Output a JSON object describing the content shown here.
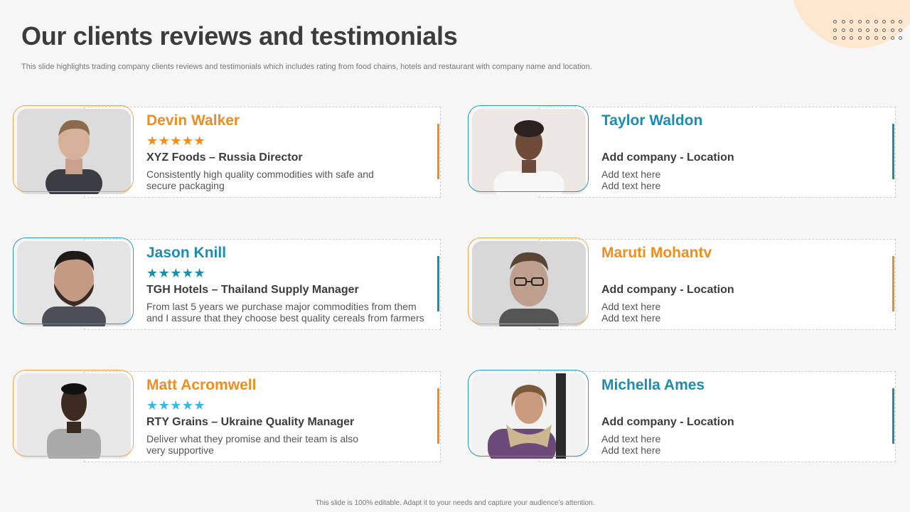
{
  "slide": {
    "title": "Our clients reviews and testimonials",
    "subtitle": "This slide highlights trading company clients reviews and testimonials which includes rating from food chains, hotels and restaurant with company name and location.",
    "footer": "This slide is 100% editable. Adapt it to your needs and capture your audience’s attention."
  },
  "colors": {
    "orange": "#ef8d1e",
    "blue": "#1c8db2",
    "star_orange": "#ef8d1e",
    "star_blue": "#1c8db2",
    "star_light_blue": "#3bb8e0",
    "background": "#f6f6f6"
  },
  "testimonials": [
    {
      "name": "Devin Walker",
      "theme": "orange",
      "rating": 5,
      "stars": "★★★★★",
      "star_color": "#ef8d1e",
      "company": "XYZ Foods – Russia Director",
      "desc_line1": "Consistently high quality commodities with safe and",
      "desc_line2": "secure packaging",
      "photo_icon": "man-portrait-photo"
    },
    {
      "name": "Taylor Waldon",
      "theme": "blue",
      "rating": null,
      "stars": "",
      "star_color": "#1c8db2",
      "company": "Add company - Location",
      "desc_line1": "Add text here",
      "desc_line2": "Add text here",
      "photo_icon": "woman-portrait-photo"
    },
    {
      "name": "Jason Knill",
      "theme": "blue",
      "rating": 5,
      "stars": "★★★★★",
      "star_color": "#1c8db2",
      "company": "TGH Hotels – Thailand Supply Manager",
      "desc_line1": "From last 5 years we purchase major commodities from them",
      "desc_line2": "and I  assure that they choose best quality cereals from farmers",
      "photo_icon": "man-portrait-photo"
    },
    {
      "name": "Maruti Mohantv",
      "theme": "orange",
      "rating": null,
      "stars": "",
      "star_color": "#ef8d1e",
      "company": "Add company - Location",
      "desc_line1": "Add text here",
      "desc_line2": "Add text here",
      "photo_icon": "man-glasses-portrait-photo"
    },
    {
      "name": "Matt Acromwell",
      "theme": "orange",
      "rating": 5,
      "stars": "★★★★★",
      "star_color": "#3bb8e0",
      "company": "RTY Grains – Ukraine Quality Manager",
      "desc_line1": "Deliver what they promise and their team is also",
      "desc_line2": "very supportive",
      "photo_icon": "man-portrait-photo"
    },
    {
      "name": "Michella Ames",
      "theme": "blue",
      "rating": null,
      "stars": "",
      "star_color": "#1c8db2",
      "company": "Add company - Location",
      "desc_line1": "Add text here",
      "desc_line2": "Add text here",
      "photo_icon": "woman-portrait-photo"
    }
  ]
}
